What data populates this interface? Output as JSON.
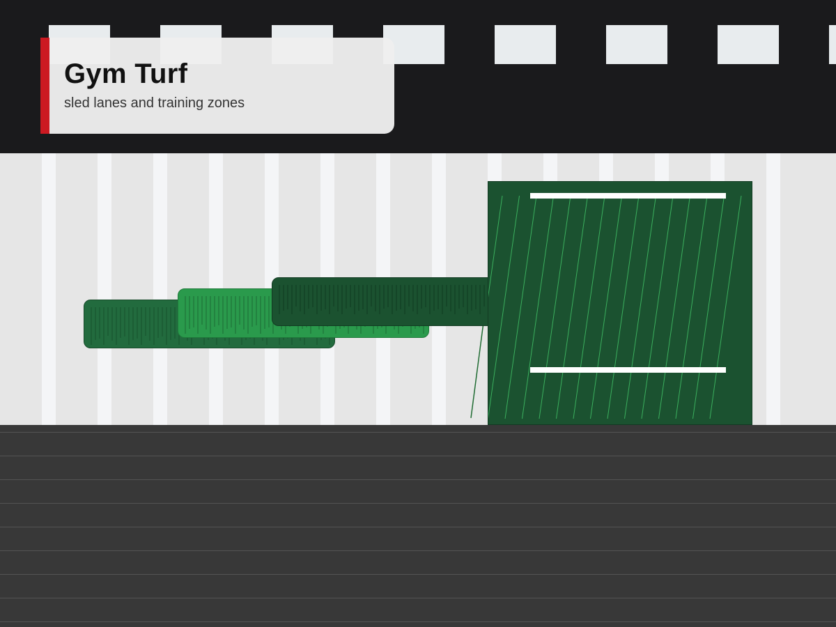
{
  "header": {
    "title": "Gym Turf",
    "subtitle": "sled lanes and training zones"
  },
  "colors": {
    "accent": "#cc1a22",
    "ceiling": "#1a1a1c",
    "wall": "#e6e6e6",
    "floor": "#383838",
    "turf_dark": "#1b5230",
    "turf_mid": "#226b3e",
    "turf_light": "#2a9a4c"
  }
}
